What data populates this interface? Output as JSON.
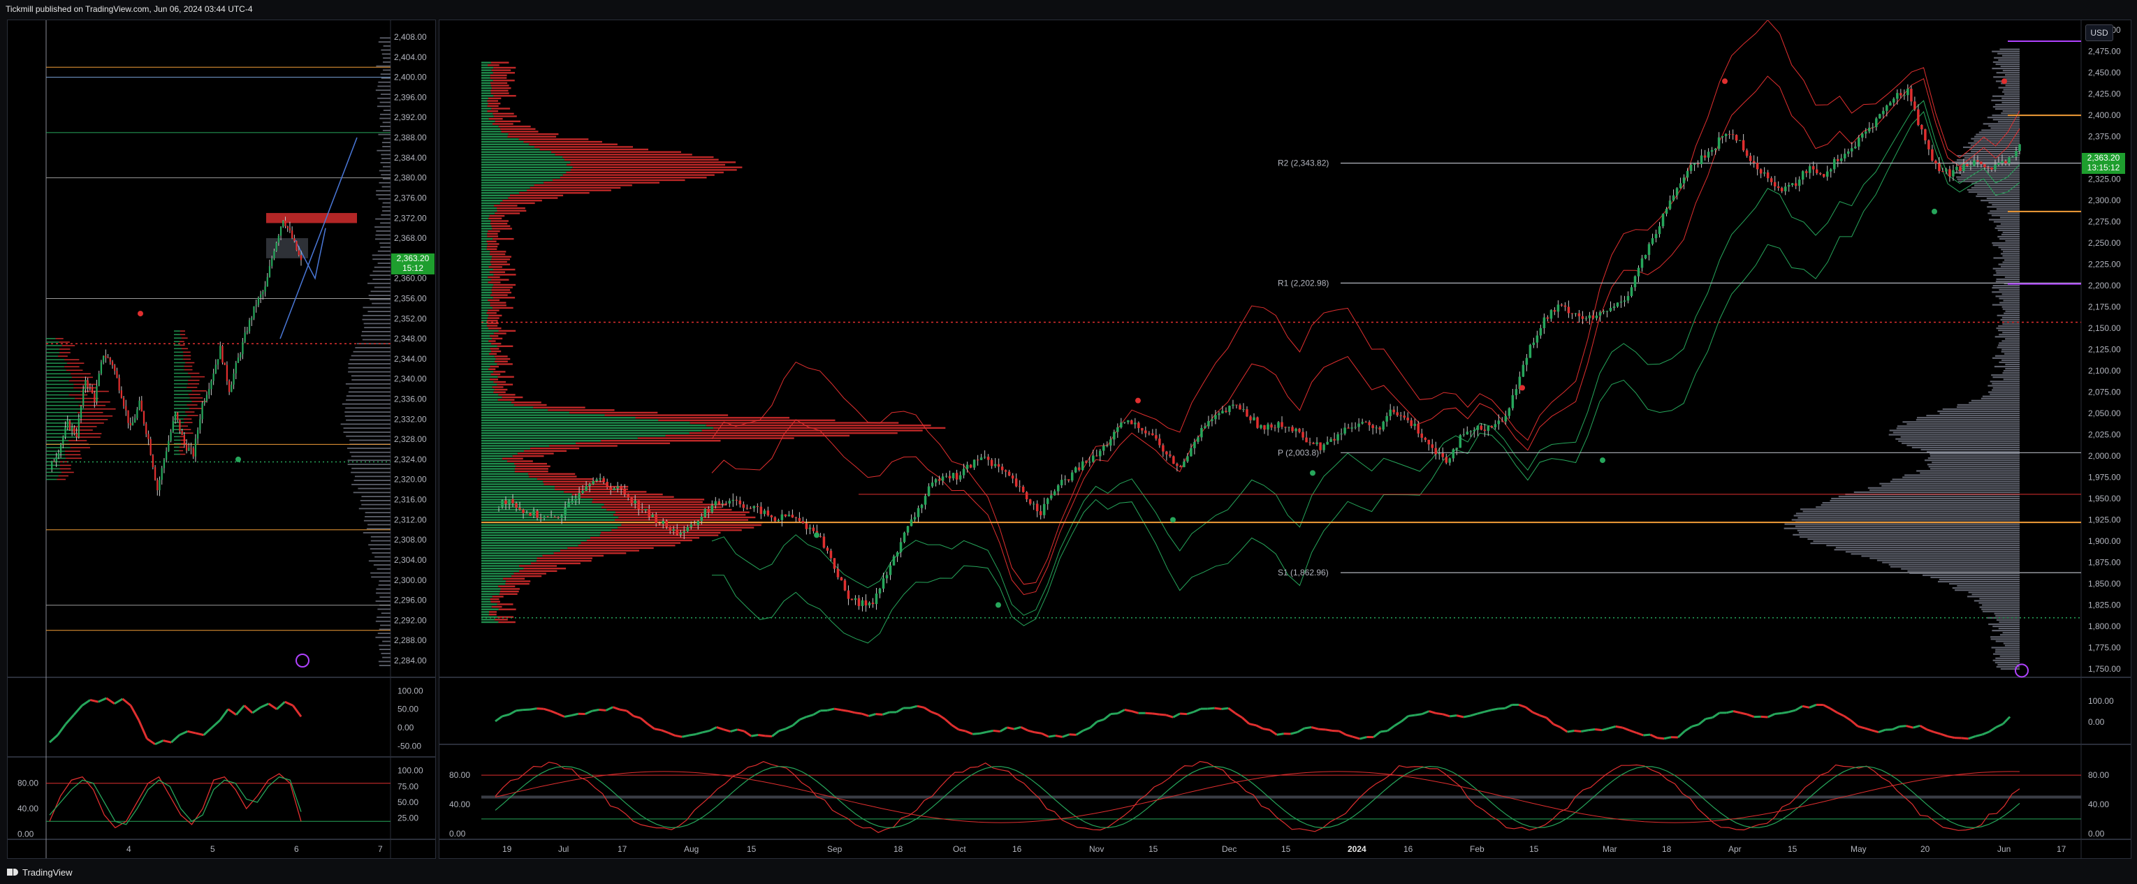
{
  "header": {
    "text": "Tickmill published on TradingView.com, Jun 06, 2024 03:44 UTC-4"
  },
  "footer": {
    "brand": "TradingView"
  },
  "currency_button": "USD",
  "colors": {
    "up": "#26a65b",
    "down": "#e02f2f",
    "price_tag": "#1e9e2e",
    "orange": "#f29d38",
    "purple": "#b042ff",
    "background": "#000000"
  },
  "chart_data": [
    {
      "id": "left-intraday",
      "type": "candlestick",
      "y_ticks": [
        "2,408.00",
        "2,404.00",
        "2,400.00",
        "2,396.00",
        "2,392.00",
        "2,388.00",
        "2,384.00",
        "2,380.00",
        "2,376.00",
        "2,372.00",
        "2,368.00",
        "2,364.00",
        "2,360.00",
        "2,356.00",
        "2,352.00",
        "2,348.00",
        "2,344.00",
        "2,340.00",
        "2,336.00",
        "2,332.00",
        "2,328.00",
        "2,324.00",
        "2,320.00",
        "2,316.00",
        "2,312.00",
        "2,308.00",
        "2,304.00",
        "2,300.00",
        "2,296.00",
        "2,292.00",
        "2,288.00",
        "2,284.00"
      ],
      "ylim": [
        2281.5,
        2410.5
      ],
      "x_ticks": [
        "4",
        "5",
        "6",
        "7"
      ],
      "last_price": "2,363.20",
      "countdown": "15:12",
      "close_series": [
        2322,
        2326,
        2331,
        2329,
        2340,
        2336,
        2345,
        2343,
        2337,
        2330,
        2335,
        2328,
        2318,
        2326,
        2333,
        2327,
        2325,
        2335,
        2340,
        2346,
        2338,
        2344,
        2350,
        2355,
        2358,
        2366,
        2372,
        2368,
        2363.2
      ]
    },
    {
      "id": "left-oscillator-1",
      "type": "line",
      "y_ticks": [
        "100.00",
        "50.00",
        "0.00",
        "-50.00"
      ],
      "ylim": [
        -70,
        110
      ],
      "values": [
        -40,
        -20,
        10,
        35,
        60,
        75,
        70,
        80,
        65,
        78,
        60,
        20,
        -30,
        -45,
        -35,
        -40,
        -20,
        -10,
        -15,
        -20,
        0,
        20,
        50,
        35,
        60,
        40,
        55,
        65,
        50,
        70,
        60,
        30
      ]
    },
    {
      "id": "left-stochastic",
      "type": "line",
      "y_ticks_left": [
        "80.00",
        "40.00",
        "0.00"
      ],
      "y_ticks_right": [
        "100.00",
        "75.00",
        "50.00",
        "25.00"
      ],
      "ylim": [
        -5,
        105
      ],
      "series": [
        {
          "values": [
            20,
            60,
            85,
            90,
            70,
            30,
            10,
            20,
            50,
            80,
            90,
            60,
            30,
            15,
            40,
            85,
            90,
            70,
            40,
            60,
            85,
            95,
            80,
            20
          ]
        },
        {
          "values": [
            30,
            50,
            70,
            85,
            80,
            50,
            20,
            15,
            40,
            70,
            85,
            75,
            40,
            20,
            30,
            70,
            85,
            80,
            55,
            50,
            75,
            90,
            85,
            35
          ]
        }
      ]
    },
    {
      "id": "right-daily",
      "type": "candlestick",
      "y_ticks": [
        "2,500.00",
        "2,475.00",
        "2,450.00",
        "2,425.00",
        "2,400.00",
        "2,375.00",
        "2,350.00",
        "2,325.00",
        "2,300.00",
        "2,275.00",
        "2,250.00",
        "2,225.00",
        "2,200.00",
        "2,175.00",
        "2,150.00",
        "2,125.00",
        "2,100.00",
        "2,075.00",
        "2,050.00",
        "2,025.00",
        "2,000.00",
        "1,975.00",
        "1,950.00",
        "1,925.00",
        "1,900.00",
        "1,875.00",
        "1,850.00",
        "1,825.00",
        "1,800.00",
        "1,775.00",
        "1,750.00"
      ],
      "ylim": [
        1745,
        2505
      ],
      "x_ticks": [
        "19",
        "Jul",
        "17",
        "Aug",
        "15",
        "Sep",
        "18",
        "Oct",
        "16",
        "Nov",
        "15",
        "Dec",
        "15",
        "2024",
        "16",
        "Feb",
        "15",
        "Mar",
        "18",
        "Apr",
        "15",
        "May",
        "20",
        "Jun",
        "17"
      ],
      "last_price": "2,363.20",
      "countdown": "13:15:12",
      "pivots": [
        {
          "label": "R2 (2,343.82)",
          "value": 2343.82
        },
        {
          "label": "R1 (2,202.98)",
          "value": 2202.98
        },
        {
          "label": "P (2,003.8)",
          "value": 2003.8
        },
        {
          "label": "S1 (1,862.96)",
          "value": 1862.96
        }
      ],
      "close_series": [
        1940,
        1950,
        1935,
        1930,
        1925,
        1935,
        1960,
        1975,
        1965,
        1960,
        1945,
        1930,
        1920,
        1910,
        1915,
        1935,
        1945,
        1950,
        1940,
        1935,
        1925,
        1930,
        1920,
        1910,
        1880,
        1840,
        1825,
        1830,
        1860,
        1900,
        1930,
        1960,
        1980,
        1975,
        1990,
        2000,
        1985,
        1970,
        1950,
        1935,
        1960,
        1975,
        1990,
        2000,
        2020,
        2040,
        2035,
        2025,
        2000,
        1985,
        2020,
        2040,
        2050,
        2060,
        2045,
        2030,
        2040,
        2030,
        2020,
        2010,
        2020,
        2035,
        2040,
        2030,
        2050,
        2045,
        2030,
        2010,
        1995,
        2020,
        2030,
        2035,
        2040,
        2080,
        2130,
        2160,
        2175,
        2170,
        2160,
        2165,
        2175,
        2190,
        2230,
        2260,
        2300,
        2330,
        2345,
        2360,
        2380,
        2370,
        2340,
        2330,
        2310,
        2320,
        2340,
        2330,
        2350,
        2360,
        2380,
        2400,
        2420,
        2430,
        2380,
        2340,
        2330,
        2340,
        2350,
        2335,
        2345,
        2363.2
      ]
    },
    {
      "id": "right-oscillator-1",
      "type": "line",
      "y_ticks": [
        "100.00",
        "0.00"
      ],
      "ylim": [
        -90,
        190
      ]
    },
    {
      "id": "right-stochastic",
      "type": "line",
      "y_ticks_left": [
        "80.00",
        "40.00",
        "0.00"
      ],
      "y_ticks_right": [
        "80.00",
        "40.00",
        "0.00"
      ],
      "ylim": [
        -5,
        105
      ]
    }
  ]
}
